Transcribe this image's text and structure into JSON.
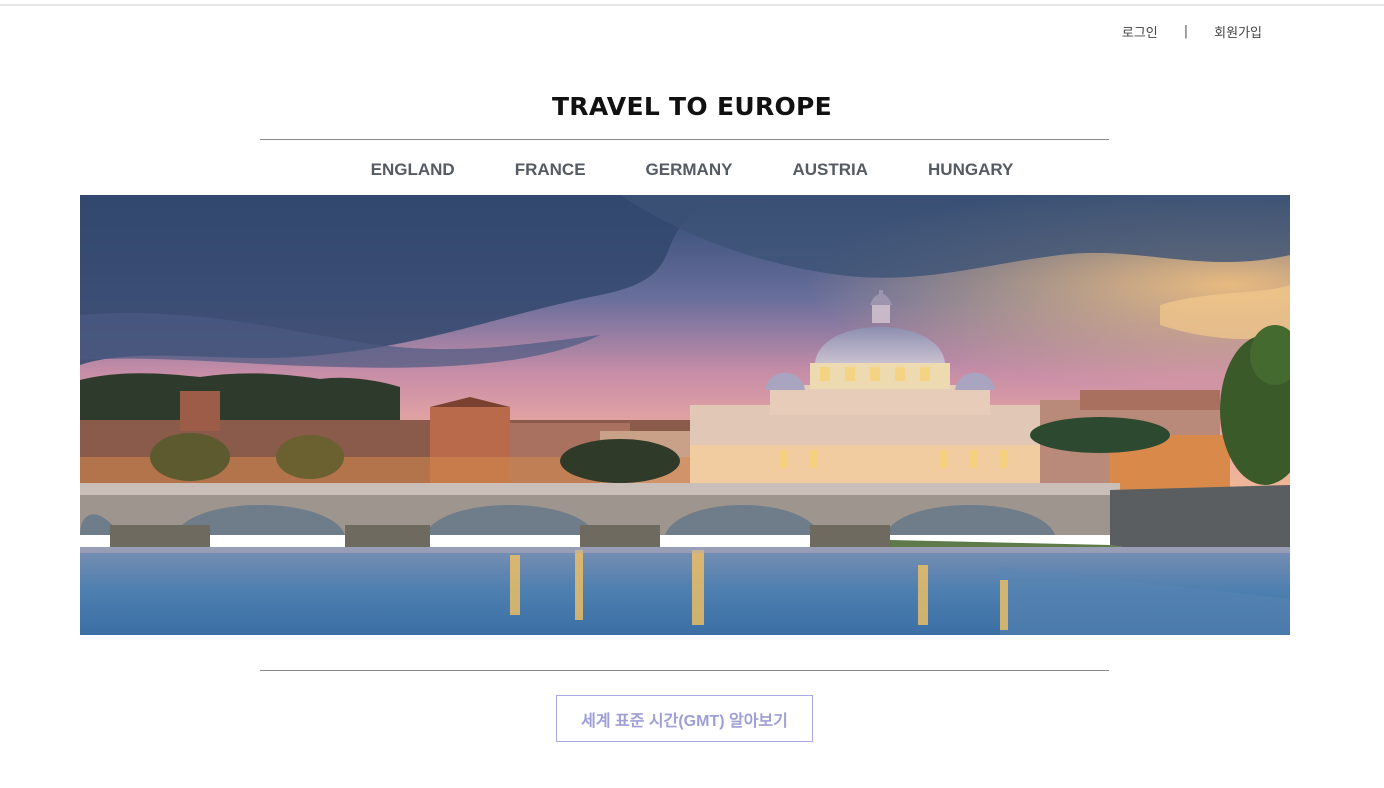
{
  "header": {
    "login_label": "로그인",
    "separator": "|",
    "signup_label": "회원가입"
  },
  "site": {
    "title": "TRAVEL TO EUROPE"
  },
  "nav": {
    "items": [
      {
        "label": "ENGLAND"
      },
      {
        "label": "FRANCE"
      },
      {
        "label": "GERMANY"
      },
      {
        "label": "AUSTRIA"
      },
      {
        "label": "HUNGARY"
      }
    ]
  },
  "hero": {
    "image_icon": "rome-vatican-sunset-photo"
  },
  "footer": {
    "gmt_button_label": "세계 표준 시간(GMT) 알아보기"
  },
  "colors": {
    "nav_text": "#555a63",
    "rule": "#8a8a8a",
    "gmt_button_border": "#a9a9e4",
    "gmt_button_text": "#9e9ed8"
  }
}
